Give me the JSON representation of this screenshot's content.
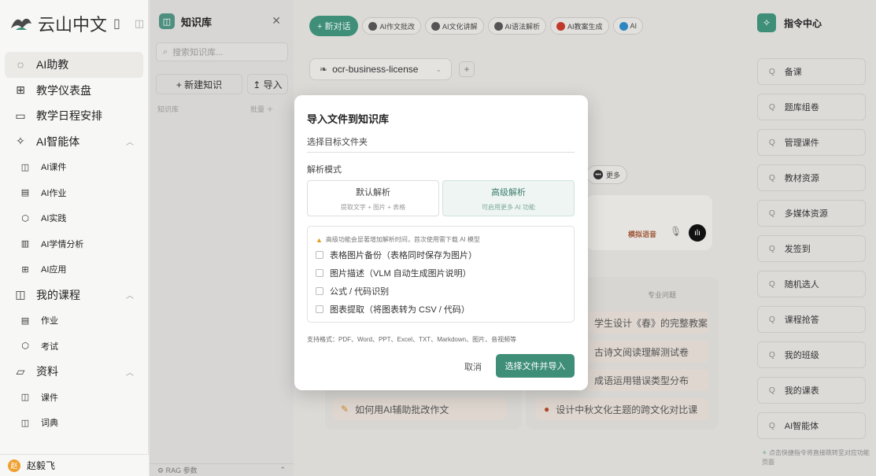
{
  "sidebar": {
    "logo_text": "云山中文",
    "items": [
      {
        "label": "AI助教",
        "icon": "chat-icon",
        "glyph": "◌",
        "type": "main",
        "active": true
      },
      {
        "label": "教学仪表盘",
        "icon": "grid-icon",
        "glyph": "⊞",
        "type": "main"
      },
      {
        "label": "教学日程安排",
        "icon": "calendar-icon",
        "glyph": "▭",
        "type": "main"
      },
      {
        "label": "AI智能体",
        "icon": "sparkle-icon",
        "glyph": "✧",
        "type": "main",
        "chevron": true
      },
      {
        "label": "AI课件",
        "icon": "book-icon",
        "glyph": "◫",
        "type": "sub"
      },
      {
        "label": "AI作业",
        "icon": "document-icon",
        "glyph": "▤",
        "type": "sub"
      },
      {
        "label": "AI实践",
        "icon": "hexagon-icon",
        "glyph": "⬡",
        "type": "sub"
      },
      {
        "label": "AI学情分析",
        "icon": "bar-chart-icon",
        "glyph": "▥",
        "type": "sub"
      },
      {
        "label": "AI应用",
        "icon": "apps-icon",
        "glyph": "⊞",
        "type": "sub"
      },
      {
        "label": "我的课程",
        "icon": "book-icon",
        "glyph": "◫",
        "type": "main",
        "chevron": true
      },
      {
        "label": "作业",
        "icon": "document-icon",
        "glyph": "▤",
        "type": "sub"
      },
      {
        "label": "考试",
        "icon": "hexagon-icon",
        "glyph": "⬡",
        "type": "sub"
      },
      {
        "label": "资料",
        "icon": "folder-icon",
        "glyph": "▱",
        "type": "main",
        "chevron": true
      },
      {
        "label": "课件",
        "icon": "book-icon",
        "glyph": "◫",
        "type": "sub"
      },
      {
        "label": "词典",
        "icon": "book-icon",
        "glyph": "◫",
        "type": "sub"
      }
    ],
    "user": {
      "avatar": "赵",
      "name": "赵毅飞"
    }
  },
  "knowledge": {
    "icon_glyph": "◫",
    "title": "知识库",
    "search_placeholder": "搜索知识库...",
    "new_button": "+ 新建知识",
    "import_button": "↥ 导入",
    "list_label": "知识库",
    "batch_label": "批量 ＋",
    "footer": "⚙ RAG 参数",
    "footer_chevron": "⌃"
  },
  "main": {
    "new_chat": "+ 新对话",
    "chips": [
      {
        "label": "AI作文批改",
        "color": "#555555"
      },
      {
        "label": "AI文化讲解",
        "color": "#555555"
      },
      {
        "label": "AI语法解析",
        "color": "#555555"
      },
      {
        "label": "AI教案生成",
        "color": "#c0392b"
      },
      {
        "label": "AI",
        "color": "#2e86c1"
      }
    ],
    "model": "ocr-business-license",
    "more_chip": "更多",
    "voice_label": "模拟语音",
    "questions_title": "专业问题",
    "questions": [
      "学生设计《春》的完整教案",
      "古诗文阅读理解测试卷",
      "成语运用错误类型分布",
      "设计中秋文化主题的跨文化对比课"
    ],
    "left_question": "如何用AI辅助批改作文"
  },
  "command_center": {
    "title": "指令中心",
    "items": [
      "备课",
      "题库组卷",
      "管理课件",
      "教材资源",
      "多媒体资源",
      "发签到",
      "随机选人",
      "课程抢答",
      "我的班级",
      "我的课表",
      "AI智能体"
    ],
    "footer": "点击快捷指令将直接跳转至对应功能页面"
  },
  "modal": {
    "title": "导入文件到知识库",
    "target_label": "选择目标文件夹",
    "mode_label": "解析模式",
    "options": [
      {
        "title": "默认解析",
        "desc": "提取文字 + 图片 + 表格",
        "selected": false
      },
      {
        "title": "高级解析",
        "desc": "可启用更多 AI 功能",
        "selected": true
      }
    ],
    "warning": "高级功能会显著增加解析时间，首次使用需下载 AI 模型",
    "checks": [
      "表格图片备份（表格同时保存为图片）",
      "图片描述（VLM 自动生成图片说明）",
      "公式 / 代码识别",
      "图表提取（将图表转为 CSV / 代码）"
    ],
    "formats": "支持格式：PDF、Word、PPT、Excel、TXT、Markdown、图片、音视频等",
    "cancel": "取消",
    "confirm": "选择文件并导入"
  }
}
